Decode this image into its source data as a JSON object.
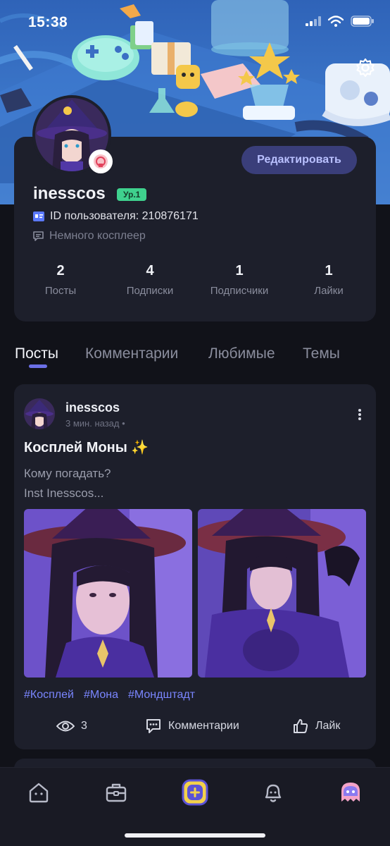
{
  "status_bar": {
    "time": "15:38"
  },
  "profile": {
    "username": "inesscos",
    "level": "Ур.1",
    "edit_label": "Редактировать",
    "user_id_text": "ID пользователя: 210876171",
    "bio": "Немного косплеер"
  },
  "stats": [
    {
      "value": "2",
      "label": "Посты"
    },
    {
      "value": "4",
      "label": "Подписки"
    },
    {
      "value": "1",
      "label": "Подписчики"
    },
    {
      "value": "1",
      "label": "Лайки"
    }
  ],
  "tabs": [
    {
      "label": "Посты",
      "active": true
    },
    {
      "label": "Комментарии",
      "active": false
    },
    {
      "label": "Любимые",
      "active": false
    },
    {
      "label": "Темы",
      "active": false
    }
  ],
  "post": {
    "author": "inesscos",
    "time": "3 мин. назад",
    "title": "Косплей Моны ✨",
    "text_lines": [
      "Кому погадать?",
      "Inst Inesscos..."
    ],
    "hashtags": [
      "#Косплей",
      "#Мона",
      "#Мондштадт"
    ],
    "views": "3",
    "comments_label": "Комментарии",
    "like_label": "Лайк"
  },
  "nav": {
    "items": [
      "home-icon",
      "briefcase-icon",
      "create-post-icon",
      "bell-icon",
      "profile-icon"
    ]
  },
  "colors": {
    "background": "#111219",
    "card": "#1d1f2b",
    "accent": "#6b6fe6",
    "hashtag": "#7a86ff",
    "level_badge": "#3fd18e",
    "edit_button": "#3a3e7a"
  }
}
